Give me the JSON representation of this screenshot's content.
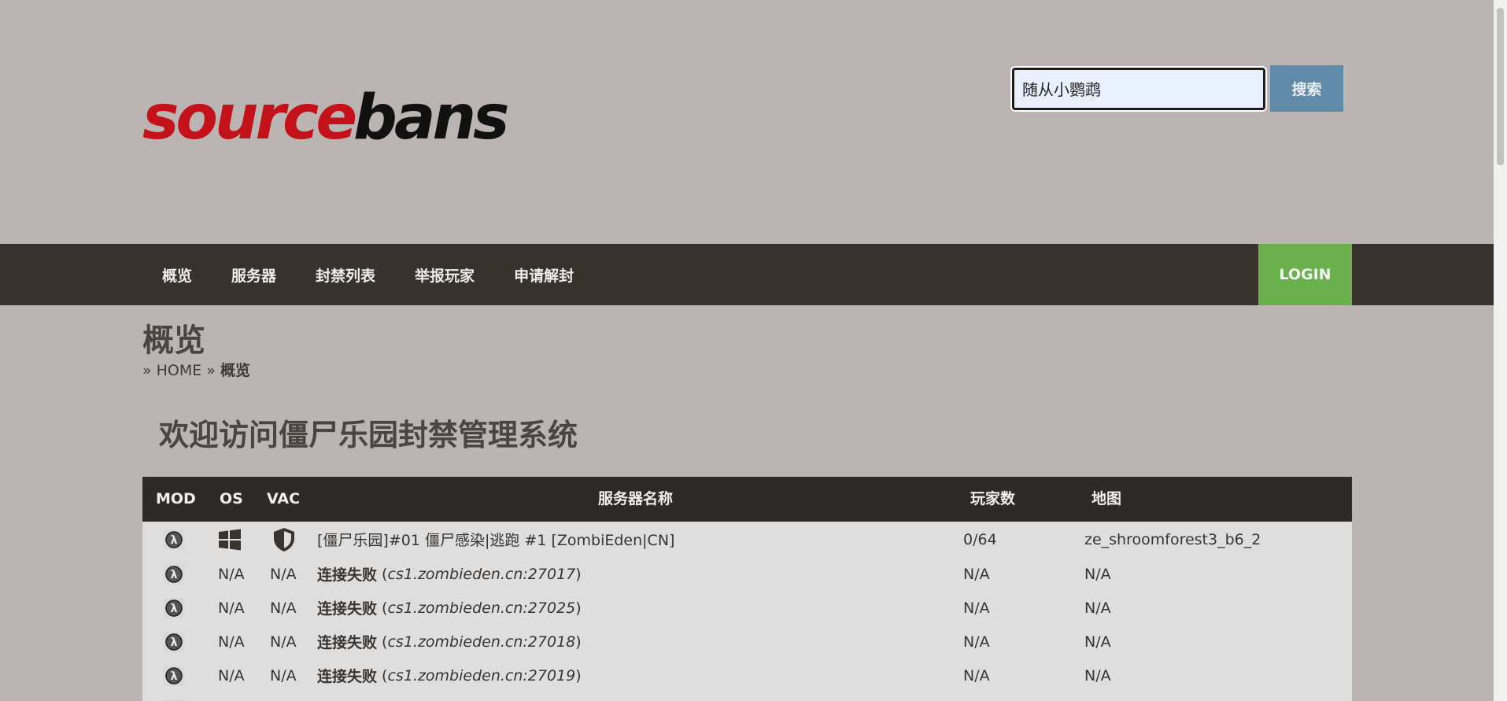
{
  "search": {
    "value": "随从小鹦鹉",
    "button_label": "搜索"
  },
  "nav": {
    "items": [
      "概览",
      "服务器",
      "封禁列表",
      "举报玩家",
      "申请解封"
    ],
    "login_label": "LOGIN"
  },
  "page": {
    "title": "概览",
    "breadcrumb": {
      "separator": "»",
      "home": "HOME",
      "current": "概览"
    },
    "welcome": "欢迎访问僵尸乐园封禁管理系统"
  },
  "servers": {
    "headers": {
      "mod": "MOD",
      "os": "OS",
      "vac": "VAC",
      "name": "服务器名称",
      "players": "玩家数",
      "map": "地图"
    },
    "rows": [
      {
        "os": "windows-icon",
        "vac": "shield-icon",
        "name": "[僵尸乐园]#01 僵尸感染|逃跑 #1 [ZombiEden|CN]",
        "players": "0/64",
        "map": "ze_shroomforest3_b6_2"
      },
      {
        "os": "N/A",
        "vac": "N/A",
        "status": "连接失败",
        "address": "cs1.zombieden.cn:27017",
        "players": "N/A",
        "map": "N/A"
      },
      {
        "os": "N/A",
        "vac": "N/A",
        "status": "连接失败",
        "address": "cs1.zombieden.cn:27025",
        "players": "N/A",
        "map": "N/A"
      },
      {
        "os": "N/A",
        "vac": "N/A",
        "status": "连接失败",
        "address": "cs1.zombieden.cn:27018",
        "players": "N/A",
        "map": "N/A"
      },
      {
        "os": "N/A",
        "vac": "N/A",
        "status": "连接失败",
        "address": "cs1.zombieden.cn:27019",
        "players": "N/A",
        "map": "N/A"
      }
    ]
  },
  "colors": {
    "nav_bg": "#37322d",
    "login_bg": "#6ab04c",
    "search_btn": "#5f8aa8",
    "page_bg": "#bab5b2"
  }
}
